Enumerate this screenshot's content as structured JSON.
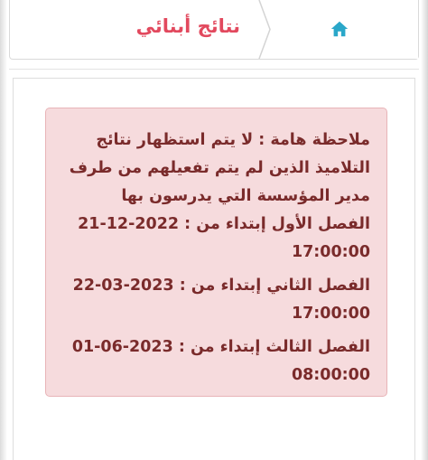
{
  "header": {
    "title": "نتائج أبنائي",
    "home_icon": "home-icon",
    "accent": "#e2495e",
    "home_color": "#2aa7c9"
  },
  "notice": {
    "lines": [
      "ملاحظة هامة : لا يتم استظهار نتائج",
      "التلاميذ الذين لم يتم تفعيلهم من طرف",
      "مدير المؤسسة التي يدرسون بها"
    ],
    "semesters": [
      {
        "label": "الفصل الأول إبتداء من :",
        "date": "21-12-2022",
        "time": "17:00:00"
      },
      {
        "label": "الفصل الثاني إبتداء من :",
        "date": "22-03-2023",
        "time": "17:00:00"
      },
      {
        "label": "الفصل الثالث إبتداء من :",
        "date": "01-06-2023",
        "time": "08:00:00"
      }
    ],
    "bg_color": "#f6dbdd",
    "text_color": "#7a2b2b"
  }
}
